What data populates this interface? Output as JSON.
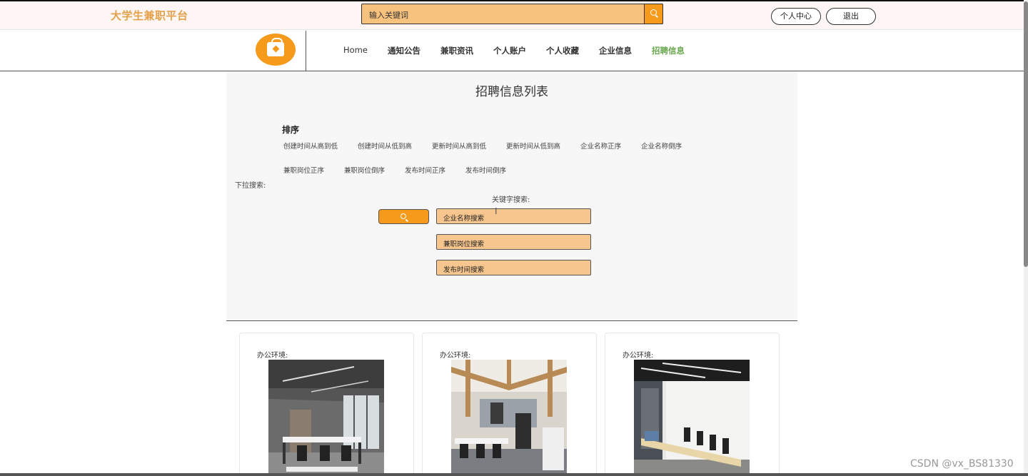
{
  "header": {
    "site_title": "大学生兼职平台",
    "search_placeholder": "输入关键词",
    "user_center": "个人中心",
    "logout": "退出"
  },
  "nav": {
    "items": [
      "Home",
      "通知公告",
      "兼职资讯",
      "个人账户",
      "个人收藏",
      "企业信息",
      "招聘信息"
    ],
    "active": "招聘信息"
  },
  "main": {
    "title": "招聘信息列表",
    "sort_title": "排序",
    "sort_options_row1": [
      "创建时间从高到低",
      "创建时间从低到高",
      "更新时间从高到低",
      "更新时间从低到高",
      "企业名称正序",
      "企业名称倒序"
    ],
    "sort_options_row2": [
      "兼职岗位正序",
      "兼职岗位倒序",
      "发布时间正序",
      "发布时间倒序"
    ],
    "dropdown_label": "下拉搜索:",
    "keyword_label": "关键字搜索:",
    "inputs": [
      "企业名称搜索",
      "兼职岗位搜索",
      "发布时间搜索"
    ]
  },
  "cards": [
    {
      "label": "办公环境:"
    },
    {
      "label": "办公环境:"
    },
    {
      "label": "办公环境:"
    }
  ],
  "watermark": "CSDN @vx_BS81330",
  "colors": {
    "accent_orange": "#f59a1a",
    "input_orange": "#f7c68e",
    "title_gold": "#e5a14a",
    "nav_active": "#6aa84f"
  }
}
